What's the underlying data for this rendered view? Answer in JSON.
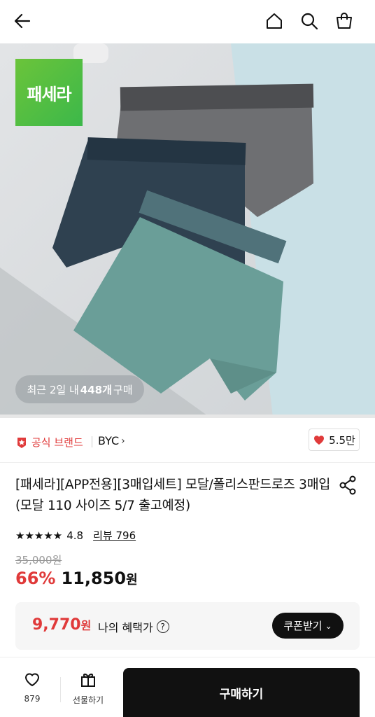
{
  "topbar": {
    "back_icon": "arrow-left-icon",
    "home_icon": "home-icon",
    "search_icon": "search-icon",
    "cart_icon": "shopping-bag-icon"
  },
  "hero": {
    "brand_logo_text": "패세라",
    "sold_prefix": "최근 2일 내 ",
    "sold_count": "448개",
    "sold_suffix": " 구매",
    "image_progress": 0.0
  },
  "brand": {
    "official_label": "공식 브랜드",
    "brand_name": "BYC",
    "likes": "5.5만",
    "colors": {
      "accent": "#e03a3a"
    }
  },
  "product": {
    "title": "[패세라][APP전용][3매입세트] 모달/폴리스판드로즈 3매입 (모달 110 사이즈 5/7 출고예정)",
    "rating": 4.8,
    "rating_text": "4.8",
    "review_label": "리뷰 796",
    "original_price": "35,000원",
    "discount": "66%",
    "price": "11,850",
    "price_unit": "원"
  },
  "benefit": {
    "price": "9,770",
    "price_unit": "원",
    "label": "나의 혜택가",
    "help_icon": "question-circle-icon",
    "coupon_label": "쿠폰받기"
  },
  "bottom": {
    "wish_count": "879",
    "gift_label": "선물하기",
    "buy_label": "구매하기"
  }
}
